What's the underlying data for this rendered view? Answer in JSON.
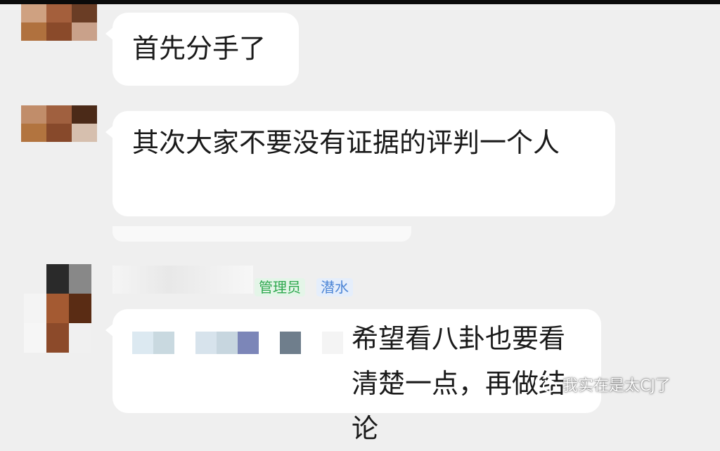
{
  "colors": {
    "background": "#efefef",
    "bubble": "#ffffff",
    "text": "#1a1a1a",
    "badge_admin": "#2fa84f",
    "badge_lurk": "#4d86d6"
  },
  "messages": [
    {
      "text": "首先分手了"
    },
    {
      "text": "其次大家不要没有证据的评判一个人"
    },
    {
      "text": "希望看八卦也要看清楚一点，再做结论"
    }
  ],
  "sender3": {
    "badges": [
      "管理员",
      "潜水"
    ]
  },
  "watermark": {
    "text": "我实在是太CJ了",
    "icon": "wechat-icon"
  }
}
